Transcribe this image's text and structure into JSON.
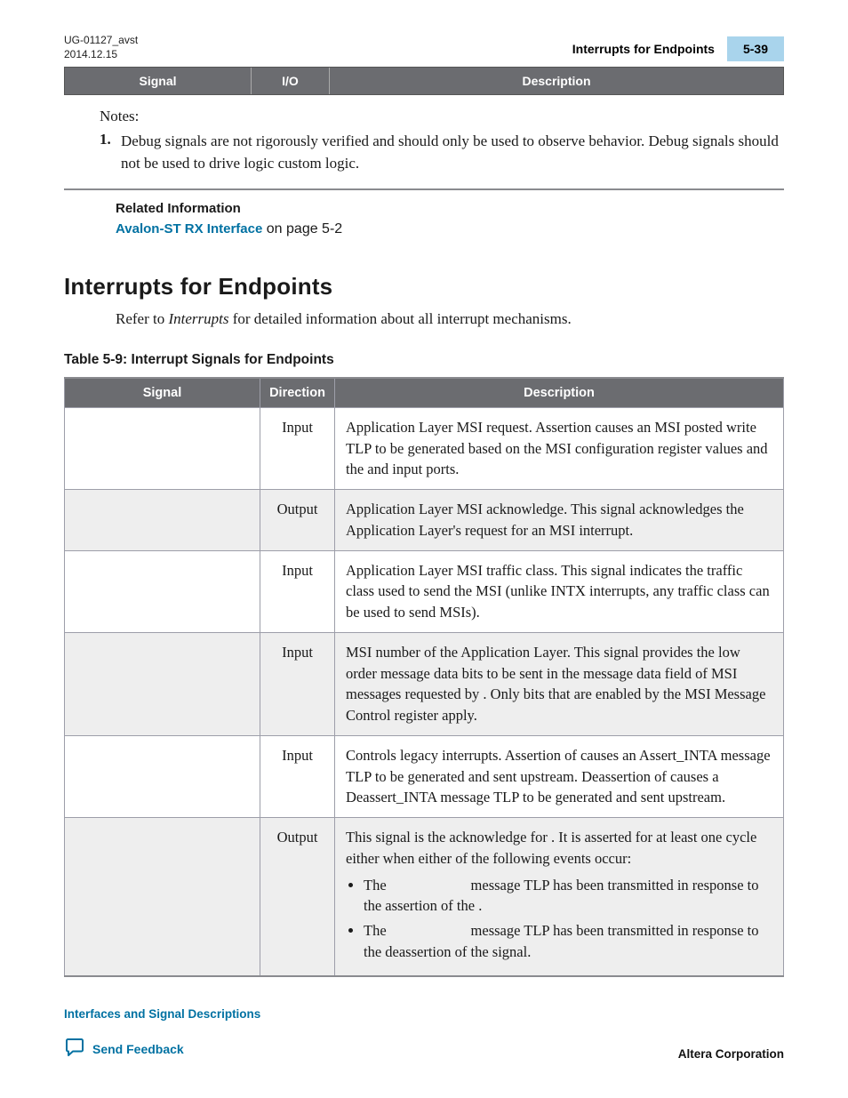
{
  "header": {
    "doc_id": "UG-01127_avst",
    "date": "2014.12.15",
    "running_title": "Interrupts for Endpoints",
    "page_no": "5-39"
  },
  "minibar": {
    "c1": "Signal",
    "c2": "I/O",
    "c3": "Description"
  },
  "notes": {
    "label": "Notes:",
    "items": [
      {
        "num": "1.",
        "text": "Debug signals are not rigorously verified and should only be used to observe behavior. Debug signals should not be used to drive logic custom logic."
      }
    ]
  },
  "related": {
    "header": "Related Information",
    "link_text": "Avalon‑ST RX Interface",
    "suffix": " on page 5-2"
  },
  "section_title": "Interrupts for Endpoints",
  "intro": {
    "pre": "Refer to ",
    "em": "Interrupts",
    "post": " for detailed information about all interrupt mechanisms."
  },
  "table_title": "Table 5-9: Interrupt Signals for Endpoints",
  "table_headers": {
    "signal": "Signal",
    "dir": "Direction",
    "desc": "Description"
  },
  "rows": [
    {
      "dir": "Input",
      "desc": "Application Layer MSI request. Assertion causes an MSI posted write TLP to be generated based on the MSI configuration register values and the                              and                              input ports."
    },
    {
      "dir": "Output",
      "desc": "Application Layer MSI acknowledge. This signal acknowledges the Application Layer's request for an MSI interrupt."
    },
    {
      "dir": "Input",
      "desc": "Application Layer MSI traffic class. This signal indicates the traffic class used to send the MSI (unlike INTX interrupts, any traffic class can be used to send MSIs)."
    },
    {
      "dir": "Input",
      "desc": "MSI number of the Application Layer. This signal provides the low order message data bits to be sent in the message data field of MSI messages requested by                           . Only bits that are enabled by the MSI Message Control register apply."
    },
    {
      "dir": "Input",
      "desc": "Controls legacy interrupts. Assertion of                                   causes an Assert_INTA message TLP to be generated and sent upstream. Deassertion of                               causes a Deassert_INTA message TLP to be generated and sent upstream."
    },
    {
      "dir": "Output",
      "desc_last": {
        "lead": "This signal is the acknowledge for                               . It is asserted for at least one cycle either when either of the following events occur:",
        "li1_a": "The ",
        "li1_b": " message TLP has been transmitted in response to the assertion of the                               .",
        "li2_a": "The ",
        "li2_b": " message TLP has been transmitted in response to the deassertion of the                          signal."
      }
    }
  ],
  "footer": {
    "left_link": "Interfaces and Signal Descriptions",
    "feedback": "Send Feedback",
    "corp": "Altera Corporation"
  }
}
